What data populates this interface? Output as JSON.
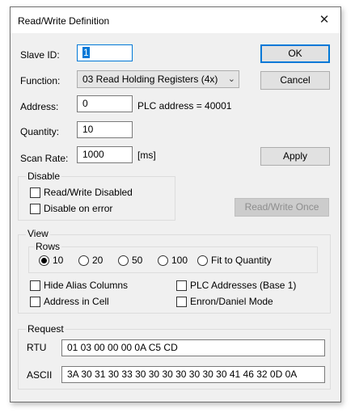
{
  "window": {
    "title": "Read/Write Definition",
    "close_glyph": "✕"
  },
  "form": {
    "slave_id_label": "Slave ID:",
    "slave_id_value": "1",
    "function_label": "Function:",
    "function_value": "03 Read Holding Registers (4x)",
    "address_label": "Address:",
    "address_value": "0",
    "plc_address_text": "PLC address = 40001",
    "quantity_label": "Quantity:",
    "quantity_value": "10",
    "scan_rate_label": "Scan Rate:",
    "scan_rate_value": "1000",
    "scan_rate_unit": "[ms]"
  },
  "buttons": {
    "ok": "OK",
    "cancel": "Cancel",
    "apply": "Apply",
    "read_write_once": "Read/Write Once"
  },
  "disable_group": {
    "title": "Disable",
    "read_write_disabled": {
      "label": "Read/Write Disabled",
      "checked": false
    },
    "disable_on_error": {
      "label": "Disable on error",
      "checked": false
    }
  },
  "view_group": {
    "title": "View",
    "rows_title": "Rows",
    "rows_options": [
      "10",
      "20",
      "50",
      "100",
      "Fit to Quantity"
    ],
    "rows_selected": "10",
    "hide_alias_columns": {
      "label": "Hide Alias Columns",
      "checked": false
    },
    "plc_addresses_base1": {
      "label": "PLC Addresses (Base 1)",
      "checked": false
    },
    "address_in_cell": {
      "label": "Address in Cell",
      "checked": false
    },
    "enron_daniel_mode": {
      "label": "Enron/Daniel Mode",
      "checked": false
    }
  },
  "request_group": {
    "title": "Request",
    "rtu_label": "RTU",
    "rtu_value": "01 03 00 00 00 0A C5 CD",
    "ascii_label": "ASCII",
    "ascii_value": "3A 30 31 30 33 30 30 30 30 30 30 30 41 46 32 0D 0A"
  },
  "icons": {
    "dropdown": "chevron-down-icon",
    "close": "close-icon"
  }
}
